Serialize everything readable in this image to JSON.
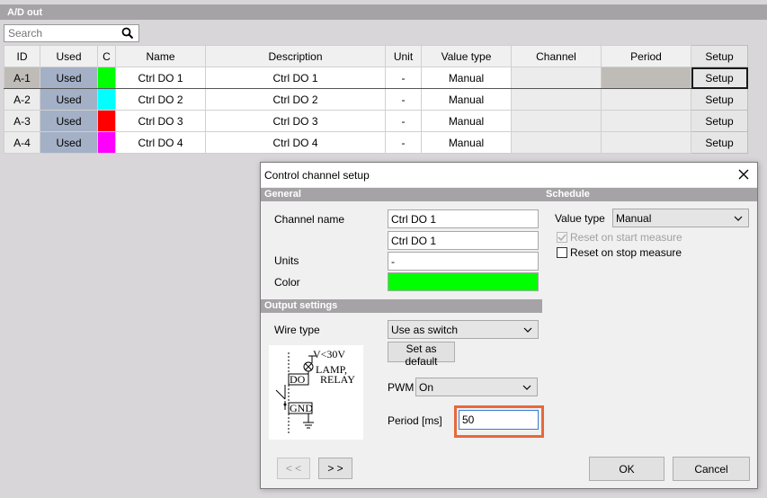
{
  "panel": {
    "title": "A/D out"
  },
  "search": {
    "placeholder": "Search",
    "icon": "search-icon"
  },
  "table": {
    "columns": [
      "ID",
      "Used",
      "C",
      "Name",
      "Description",
      "Unit",
      "Value type",
      "Channel",
      "Period",
      "Setup"
    ],
    "rows": [
      {
        "id": "A-1",
        "used": "Used",
        "color": "#00ff00",
        "name": "Ctrl DO 1",
        "description": "Ctrl DO 1",
        "unit": "-",
        "value_type": "Manual",
        "channel": "",
        "period": "",
        "setup": "Setup"
      },
      {
        "id": "A-2",
        "used": "Used",
        "color": "#00ffff",
        "name": "Ctrl DO 2",
        "description": "Ctrl DO 2",
        "unit": "-",
        "value_type": "Manual",
        "channel": "",
        "period": "",
        "setup": "Setup"
      },
      {
        "id": "A-3",
        "used": "Used",
        "color": "#ff0000",
        "name": "Ctrl DO 3",
        "description": "Ctrl DO 3",
        "unit": "-",
        "value_type": "Manual",
        "channel": "",
        "period": "",
        "setup": "Setup"
      },
      {
        "id": "A-4",
        "used": "Used",
        "color": "#ff00ff",
        "name": "Ctrl DO 4",
        "description": "Ctrl DO 4",
        "unit": "-",
        "value_type": "Manual",
        "channel": "",
        "period": "",
        "setup": "Setup"
      }
    ]
  },
  "dialog": {
    "title": "Control channel setup",
    "close_icon": "close-icon",
    "general": {
      "header": "General",
      "channel_name_label": "Channel name",
      "channel_name_value": "Ctrl DO 1",
      "description_value": "Ctrl DO 1",
      "units_label": "Units",
      "units_value": "-",
      "color_label": "Color",
      "color_value": "#00ff00"
    },
    "schedule": {
      "header": "Schedule",
      "value_type_label": "Value type",
      "value_type_value": "Manual",
      "reset_on_start": {
        "label": "Reset on start measure",
        "checked": true,
        "enabled": false
      },
      "reset_on_stop": {
        "label": "Reset on stop measure",
        "checked": false,
        "enabled": true
      }
    },
    "output": {
      "header": "Output settings",
      "wire_type_label": "Wire type",
      "wire_type_value": "Use as switch",
      "set_default_label": "Set as default",
      "pwm_label": "PWM",
      "pwm_value": "On",
      "period_label": "Period [ms]",
      "period_value": "50",
      "diagram": {
        "voltage": "V<30V",
        "load_line1": "LAMP,",
        "load_line2": "RELAY",
        "do": "DO",
        "gnd": "GND"
      }
    },
    "buttons": {
      "prev": "< <",
      "next": "> >",
      "ok": "OK",
      "cancel": "Cancel"
    }
  }
}
